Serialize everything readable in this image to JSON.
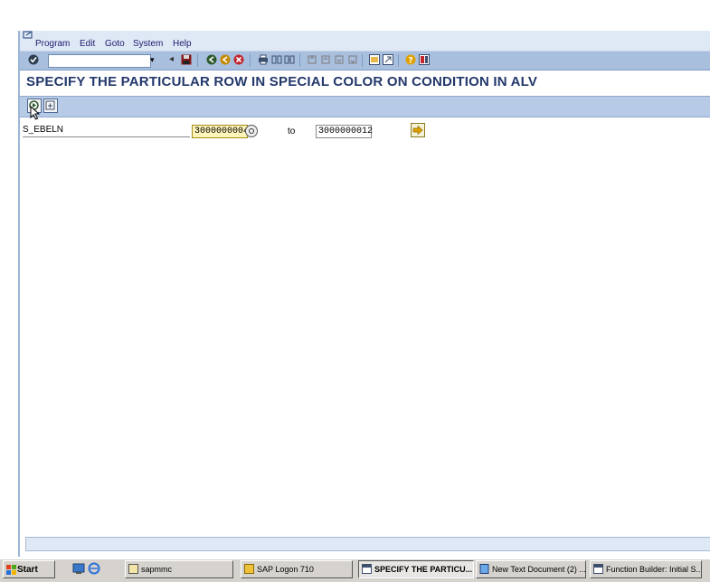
{
  "menu": [
    "Program",
    "Edit",
    "Goto",
    "System",
    "Help"
  ],
  "page_title": "SPECIFY THE PARTICULAR ROW IN SPECIAL COLOR ON CONDITION IN ALV",
  "selection": {
    "label": "S_EBELN",
    "low": "3000000004",
    "to_label": "to",
    "high": "3000000012"
  },
  "taskbar": {
    "start": "Start",
    "items": [
      "sapmmc",
      "SAP Logon 710",
      "SPECIFY THE PARTICU...",
      "New Text Document (2) ...",
      "Function Builder: Initial S..."
    ]
  },
  "colors": {
    "toolbar": "#a9bfde",
    "title": "#23386b",
    "required_field": "#fff5b8"
  }
}
